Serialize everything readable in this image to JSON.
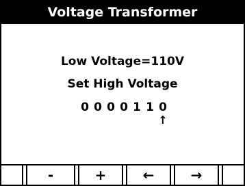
{
  "title": "Voltage Transformer",
  "low_voltage_text": "Low Voltage=110V",
  "set_high_voltage_text": "Set High Voltage",
  "digits": [
    "0",
    "0",
    "0",
    "0",
    "1",
    "1",
    "0"
  ],
  "cursor_symbol": "↑",
  "cursor_index": 6,
  "softkeys": {
    "minus": "-",
    "plus": "+",
    "left": "←",
    "right": "→"
  }
}
